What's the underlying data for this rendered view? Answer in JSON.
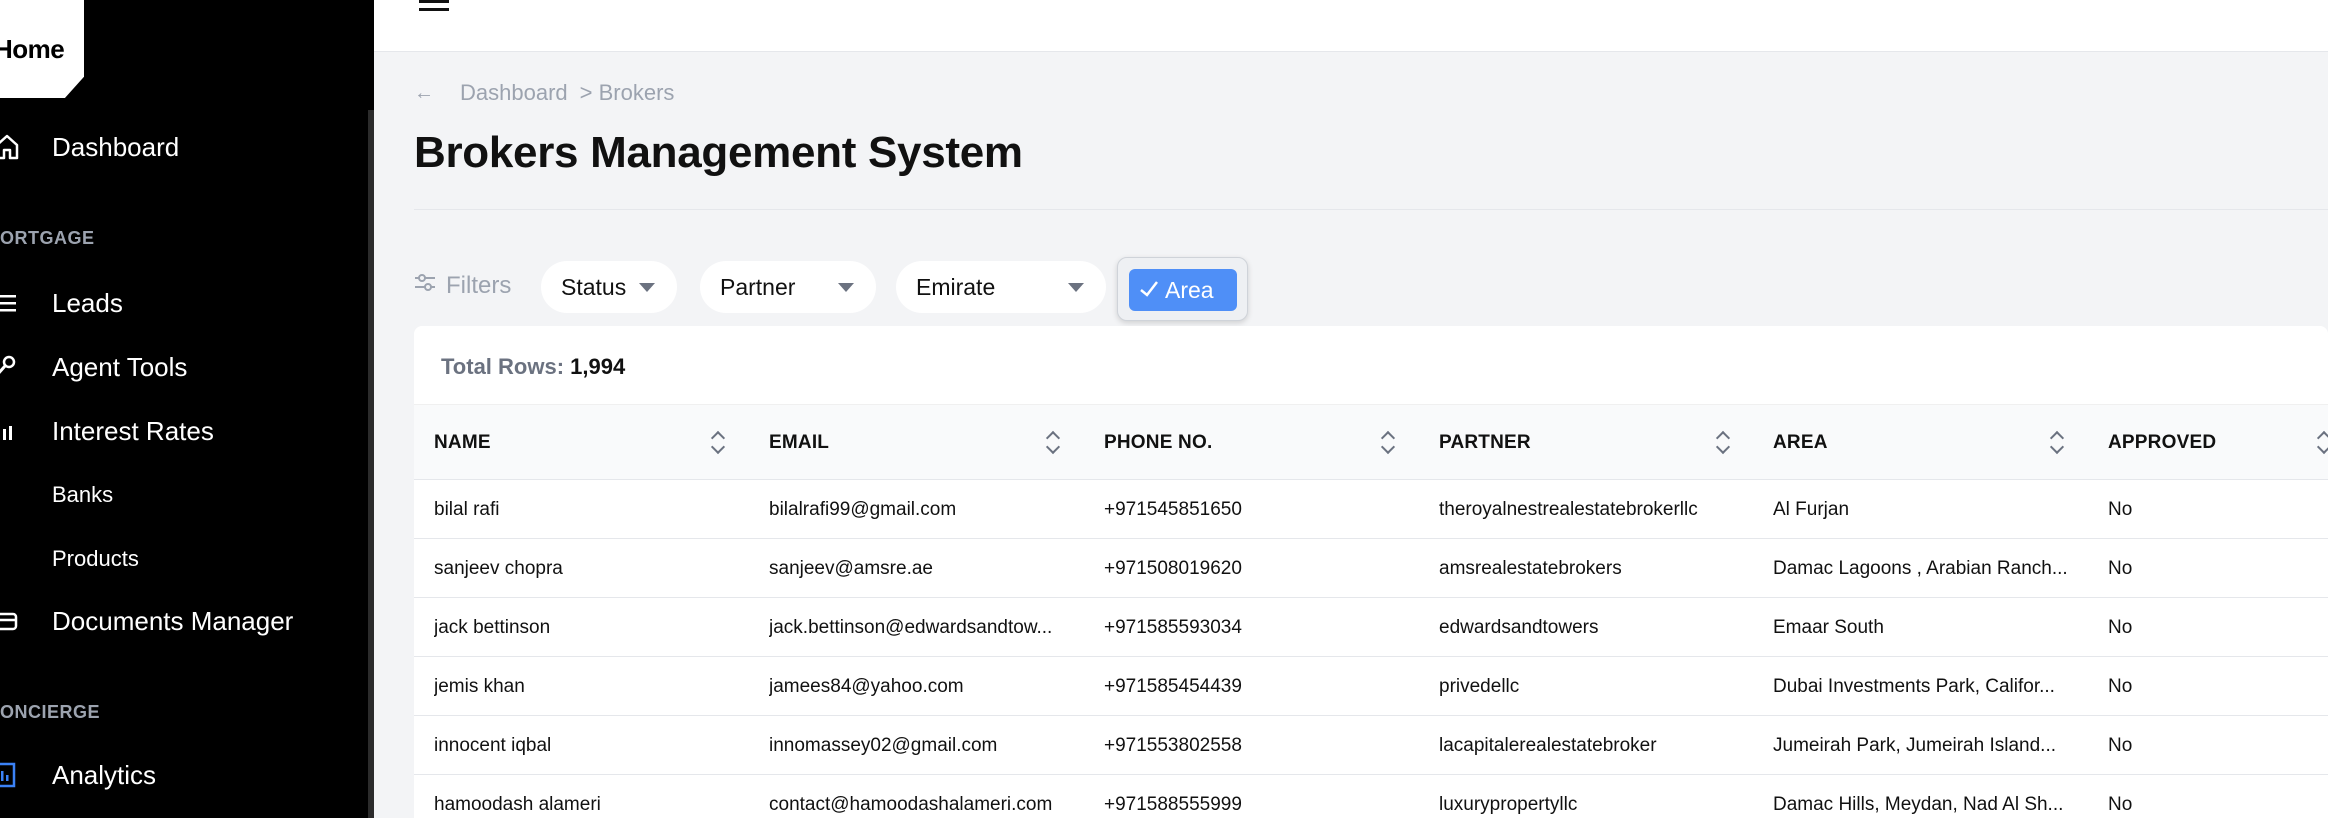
{
  "sidebar": {
    "logo": "Home",
    "items": [
      {
        "label": "Dashboard",
        "icon": "home-icon"
      },
      {
        "section": "ORTGAGE"
      },
      {
        "label": "Leads",
        "icon": "list-icon"
      },
      {
        "label": "Agent Tools",
        "icon": "wrench-icon"
      },
      {
        "label": "Interest Rates",
        "icon": "bar-chart-icon"
      },
      {
        "label": "Banks"
      },
      {
        "label": "Products"
      },
      {
        "label": "Documents Manager",
        "icon": "folder-icon"
      },
      {
        "section": "ONCIERGE"
      },
      {
        "label": "Analytics",
        "icon": "analytics-icon"
      }
    ]
  },
  "breadcrumb": {
    "items": [
      "Dashboard",
      "> Brokers"
    ]
  },
  "page": {
    "title": "Brokers Management System"
  },
  "filters": {
    "label": "Filters",
    "status": "Status",
    "partner": "Partner",
    "emirate": "Emirate",
    "area": "Area"
  },
  "table": {
    "total_label": "Total Rows:",
    "total_value": "1,994",
    "columns": [
      "NAME",
      "EMAIL",
      "PHONE NO.",
      "PARTNER",
      "AREA",
      "APPROVED"
    ],
    "rows": [
      [
        "bilal rafi",
        "bilalrafi99@gmail.com",
        "+971545851650",
        "theroyalnestrealestatebrokerllc",
        "Al Furjan",
        "No"
      ],
      [
        "sanjeev chopra",
        "sanjeev@amsre.ae",
        "+971508019620",
        "amsrealestatebrokers",
        "Damac Lagoons , Arabian Ranch...",
        "No"
      ],
      [
        "jack bettinson",
        "jack.bettinson@edwardsandtow...",
        "+971585593034",
        "edwardsandtowers",
        "Emaar South",
        "No"
      ],
      [
        "jemis khan",
        "jamees84@yahoo.com",
        "+971585454439",
        "privedellc",
        "Dubai Investments Park, Califor...",
        "No"
      ],
      [
        "innocent iqbal",
        "innomassey02@gmail.com",
        "+971553802558",
        "lacapitalerealestatebroker",
        "Jumeirah Park, Jumeirah Island...",
        "No"
      ],
      [
        "hamoodash alameri",
        "contact@hamoodashalameri.com",
        "+971588555999",
        "luxurypropertyllc",
        "Damac Hills, Meydan, Nad Al Sh...",
        "No"
      ]
    ]
  },
  "colors": {
    "accent": "#4f8ff7",
    "sidebar_bg": "#000000",
    "page_bg": "#f3f4f6"
  }
}
